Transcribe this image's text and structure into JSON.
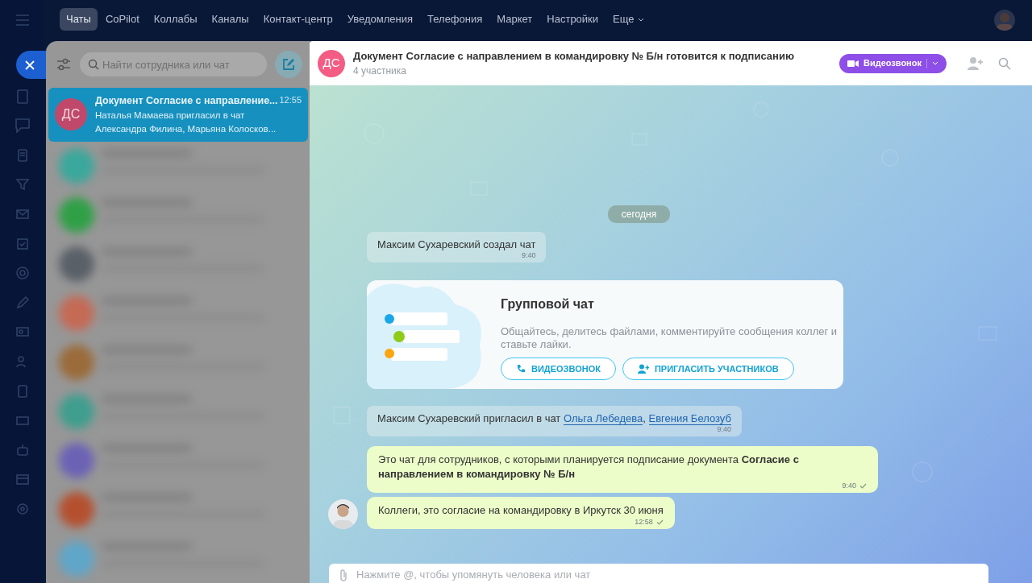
{
  "top_menu": [
    {
      "label": "Чаты",
      "selected": true
    },
    {
      "label": "CoPilot",
      "selected": false
    },
    {
      "label": "Коллабы",
      "selected": false
    },
    {
      "label": "Каналы",
      "selected": false
    },
    {
      "label": "Контакт-центр",
      "selected": false
    },
    {
      "label": "Уведомления",
      "selected": false
    },
    {
      "label": "Телефония",
      "selected": false
    },
    {
      "label": "Маркет",
      "selected": false
    },
    {
      "label": "Настройки",
      "selected": false
    },
    {
      "label": "Еще",
      "selected": false,
      "dropdown": true
    }
  ],
  "chat_list": {
    "search": {
      "placeholder": "Найти сотрудника или чат"
    },
    "items": [
      {
        "initials": "ДС",
        "title": "Документ Согласие с направление...",
        "time": "12:55",
        "preview": "Наталья Мамаева пригласил в чат Александра Филина, Марьяна Колосков...",
        "selected": true
      }
    ]
  },
  "chat": {
    "initials": "ДС",
    "title": "Документ Согласие с направлением в командировку № Б/н готовится к подписанию",
    "subtitle": "4 участника",
    "video_button": "Видеозвонок",
    "date_divider": "сегодня",
    "messages": [
      {
        "kind": "system",
        "text": "Максим Сухаревский создал чат",
        "time": "9:40"
      },
      {
        "kind": "intro",
        "title": "Групповой чат",
        "text": "Общайтесь, делитесь файлами, комментируйте сообщения коллег и ставьте лайки.",
        "buttons": [
          {
            "kind": "call",
            "label": "ВИДЕОЗВОНОК"
          },
          {
            "kind": "invite",
            "label": "ПРИГЛАСИТЬ УЧАСТНИКОВ"
          }
        ]
      },
      {
        "kind": "system",
        "text": "Максим Сухаревский пригласил в чат",
        "links": [
          "Ольга Лебедева",
          "Евгения Белозуб"
        ],
        "separator": ",",
        "time": "9:40"
      },
      {
        "kind": "outgoing",
        "text": "Это чат для сотрудников, с которыми планируется подписание документа **Согласие с направлением в командировку № Б/н**",
        "time": "9:40",
        "delivered": true,
        "avatar": false
      },
      {
        "kind": "outgoing",
        "text": "Коллеги, это согласие на командировку в Иркутск 30 июня",
        "time": "12:58",
        "delivered": true,
        "avatar": true
      }
    ],
    "input": {
      "placeholder": "Нажмите @, чтобы упомянуть человека или чат"
    }
  }
}
